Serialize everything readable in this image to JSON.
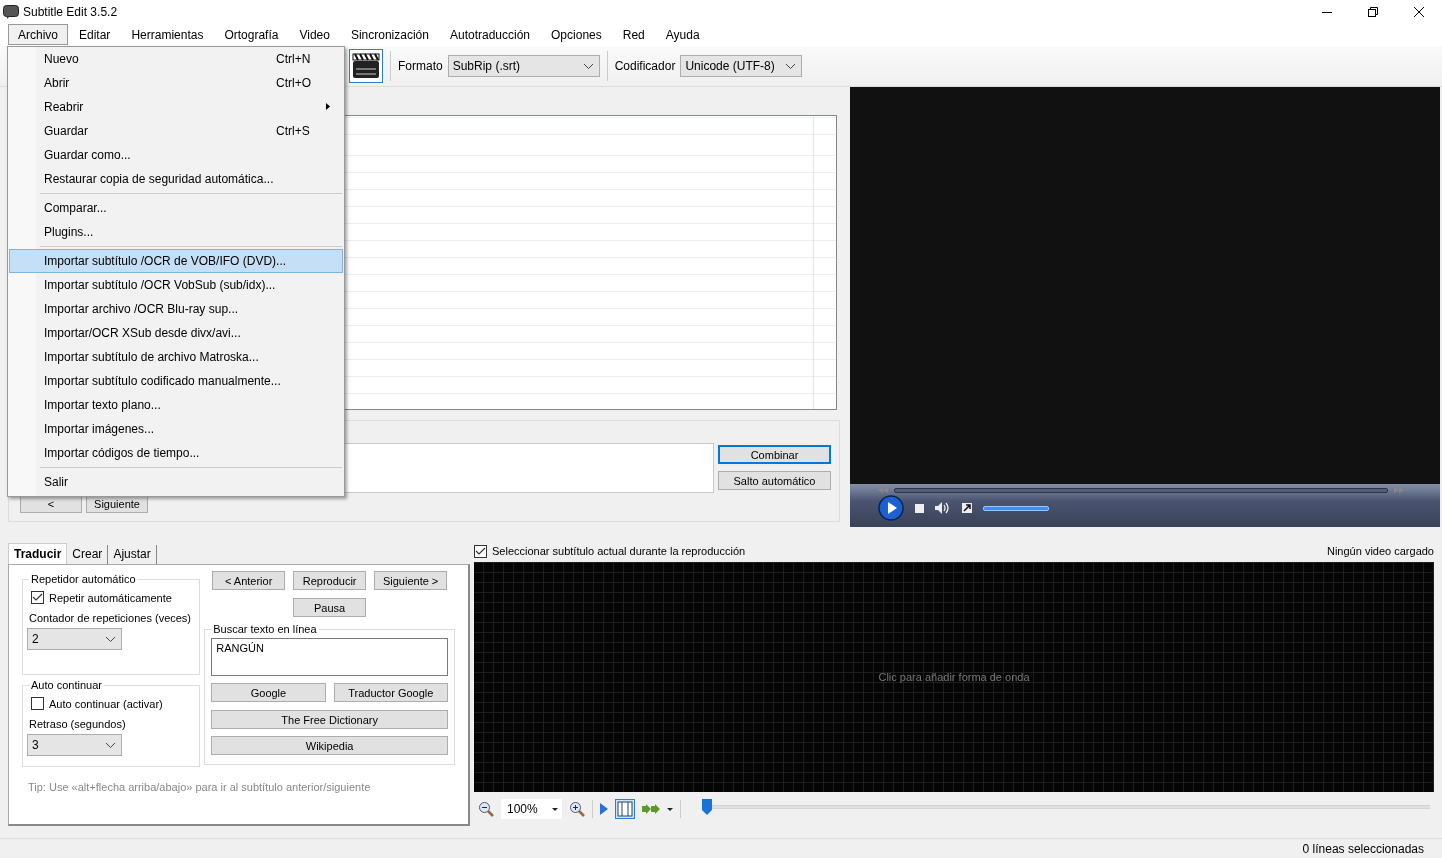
{
  "window": {
    "title": "Subtitle Edit 3.5.2"
  },
  "menu_bar": [
    {
      "label": "Archivo",
      "selected": true
    },
    {
      "label": "Editar",
      "selected": false
    },
    {
      "label": "Herramientas",
      "selected": false
    },
    {
      "label": "Ortografía",
      "selected": false
    },
    {
      "label": "Video",
      "selected": false
    },
    {
      "label": "Sincronización",
      "selected": false
    },
    {
      "label": "Autotraducción",
      "selected": false
    },
    {
      "label": "Opciones",
      "selected": false
    },
    {
      "label": "Red",
      "selected": false
    },
    {
      "label": "Ayuda",
      "selected": false
    }
  ],
  "file_menu": [
    {
      "kind": "item",
      "label": "Nuevo",
      "shortcut": "Ctrl+N",
      "selected": false
    },
    {
      "kind": "item",
      "label": "Abrir",
      "shortcut": "Ctrl+O",
      "selected": false
    },
    {
      "kind": "submenu",
      "label": "Reabrir",
      "selected": false
    },
    {
      "kind": "item",
      "label": "Guardar",
      "shortcut": "Ctrl+S",
      "selected": false
    },
    {
      "kind": "item",
      "label": "Guardar como...",
      "selected": false
    },
    {
      "kind": "item",
      "label": "Restaurar copia de seguridad automática...",
      "selected": false
    },
    {
      "kind": "separator"
    },
    {
      "kind": "item",
      "label": "Comparar...",
      "selected": false
    },
    {
      "kind": "item",
      "label": "Plugins...",
      "selected": false
    },
    {
      "kind": "separator"
    },
    {
      "kind": "item",
      "label": "Importar subtítulo /OCR de VOB/IFO (DVD)...",
      "selected": true
    },
    {
      "kind": "item",
      "label": "Importar subtítulo /OCR VobSub (sub/idx)...",
      "selected": false
    },
    {
      "kind": "item",
      "label": "Importar archivo /OCR Blu-ray sup...",
      "selected": false
    },
    {
      "kind": "item",
      "label": "Importar/OCR XSub desde divx/avi...",
      "selected": false
    },
    {
      "kind": "item",
      "label": "Importar subtítulo de archivo Matroska...",
      "selected": false
    },
    {
      "kind": "item",
      "label": "Importar subtítulo codificado manualmente...",
      "selected": false
    },
    {
      "kind": "item",
      "label": "Importar texto plano...",
      "selected": false
    },
    {
      "kind": "item",
      "label": "Importar imágenes...",
      "selected": false
    },
    {
      "kind": "item",
      "label": "Importar códigos de tiempo...",
      "selected": false
    },
    {
      "kind": "separator"
    },
    {
      "kind": "item",
      "label": "Salir",
      "selected": false
    }
  ],
  "toolbar": {
    "format_label": "Formato",
    "format": "SubRip (.srt)",
    "encoding_label": "Codificador",
    "encoding": "Unicode (UTF-8)"
  },
  "editor": {
    "combine": "Combinar",
    "auto_break": "Salto automático",
    "previous": "<",
    "next": "Siguiente"
  },
  "tabs": [
    {
      "label": "Traducir",
      "selected": true
    },
    {
      "label": "Crear",
      "selected": false
    },
    {
      "label": "Ajustar",
      "selected": false
    }
  ],
  "auto_repeat": {
    "title": "Repetidor automático",
    "checkbox": {
      "label": "Repetir automáticamente",
      "checked": true
    },
    "count_label": "Contador de repeticiones (veces)",
    "count": "2"
  },
  "auto_continue": {
    "title": "Auto continuar",
    "checkbox": {
      "label": "Auto continuar (activar)",
      "checked": false
    },
    "delay_label": "Retraso (segundos)",
    "delay": "3"
  },
  "playback": {
    "previous": "< Anterior",
    "play": "Reproducir",
    "next": "Siguiente >",
    "pause": "Pausa"
  },
  "search_online": {
    "title": "Buscar texto en línea",
    "value": "RANGÚN",
    "google": "Google",
    "google_translate": "Traductor Google",
    "dictionary": "The Free Dictionary",
    "wikipedia": "Wikipedia"
  },
  "tip": "Tip: Use «alt+flecha arriba/abajo» para ir al subtítulo anterior/siguiente",
  "waveform": {
    "select_current": {
      "label": "Seleccionar subtítulo actual durante la reproducción",
      "checked": true
    },
    "video_status": "Ningún video cargado",
    "placeholder": "Clic para añadir forma de onda",
    "zoom": "100%",
    "position": {
      "level": 0
    }
  },
  "status_bar": "0 líneas seleccionadas"
}
